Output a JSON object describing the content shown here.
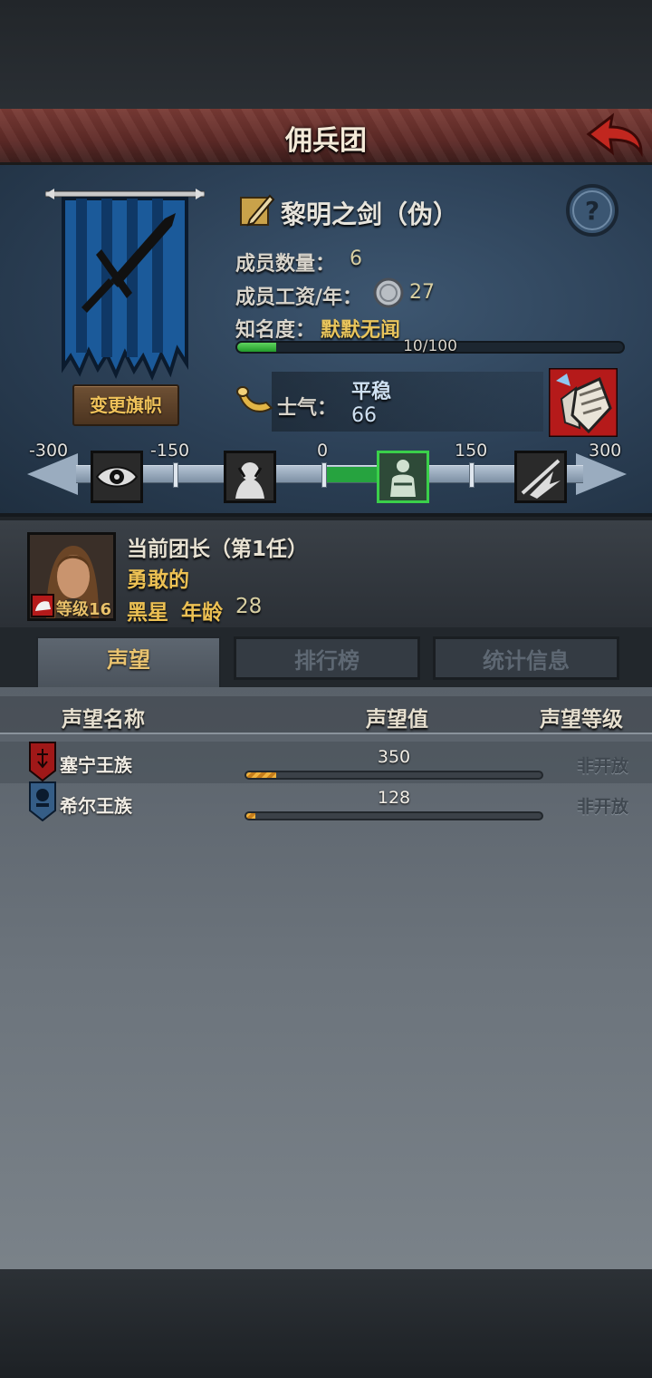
{
  "header": {
    "title": "佣兵团"
  },
  "corps": {
    "name": "黎明之剑（伪）",
    "change_flag_label": "变更旗帜",
    "members_label": "成员数量：",
    "members_value": "6",
    "wage_label": "成员工资/年：",
    "wage_value": "27",
    "fame_label": "知名度：",
    "fame_value": "默默无闻",
    "fame_progress_text": "10/100",
    "fame_progress": 0.1,
    "morale_label": "士气：",
    "morale_state": "平稳",
    "morale_value": "66"
  },
  "morale_scale": {
    "ticks": [
      "-300",
      "-150",
      "0",
      "150",
      "300"
    ],
    "icons": [
      "eye-icon",
      "despair-icon",
      "steady-icon",
      "charge-icon"
    ],
    "active_index": 2,
    "value": 66
  },
  "commander": {
    "title": "当前团长（第1任）",
    "trait": "勇敢的",
    "name": "黑星",
    "age_label": "年龄",
    "age": "28",
    "level_label": "等级16"
  },
  "tabs": [
    {
      "label": "声望",
      "active": true
    },
    {
      "label": "排行榜",
      "active": false
    },
    {
      "label": "统计信息",
      "active": false
    }
  ],
  "reputation": {
    "headers": {
      "name": "声望名称",
      "value": "声望值",
      "level": "声望等级"
    },
    "rows": [
      {
        "name": "塞宁王族",
        "value": "350",
        "level": "非开放",
        "fill": 0.1,
        "emblem": "red-banner-icon"
      },
      {
        "name": "希尔王族",
        "value": "128",
        "level": "非开放",
        "fill": 0.03,
        "emblem": "blue-banner-icon"
      }
    ]
  },
  "colors": {
    "accent_gold": "#ecc053",
    "title_bar": "#6b312d",
    "morale_green": "#26a33f",
    "rep_bar": "#f0b23c"
  }
}
